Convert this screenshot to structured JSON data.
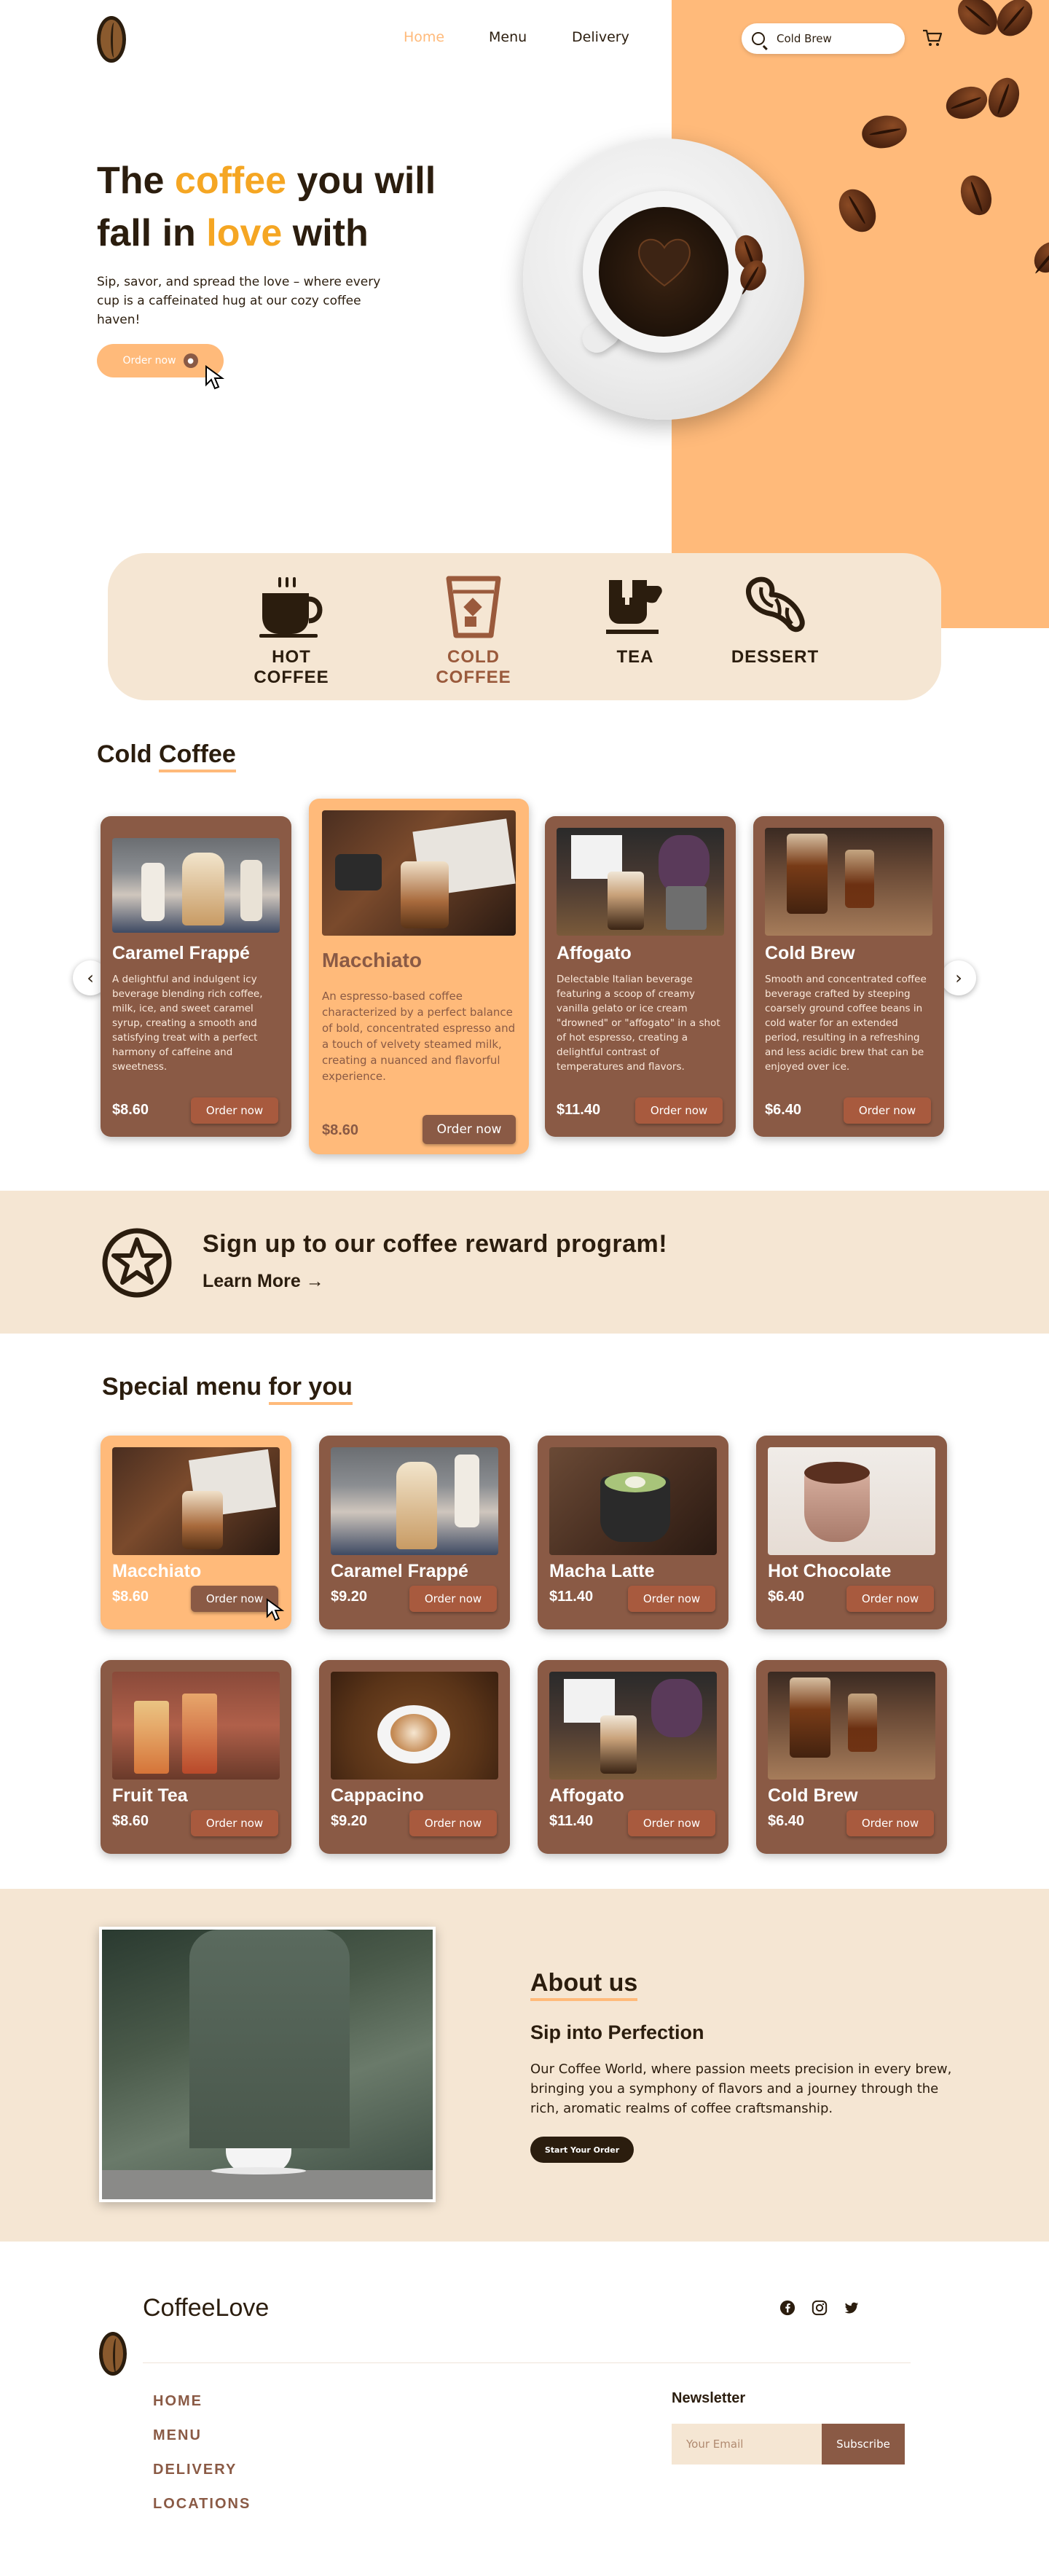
{
  "nav": {
    "items": [
      "Home",
      "Menu",
      "Delivery"
    ],
    "search_value": "Cold Brew"
  },
  "hero": {
    "title_part1": "The ",
    "title_hl1": "coffee",
    "title_part2": " you will",
    "title_part3": "fall in ",
    "title_hl2": "love",
    "title_part4": " with",
    "subtitle": "Sip, savor, and spread the love – where every cup is a caffeinated hug at our cozy coffee haven!",
    "cta": "Order now"
  },
  "categories": [
    {
      "label": "HOT COFFEE",
      "icon": "hot-coffee-cup-icon",
      "active": false
    },
    {
      "label": "COLD COFFEE",
      "icon": "cold-coffee-glass-icon",
      "active": true
    },
    {
      "label": "TEA",
      "icon": "tea-cup-icon",
      "active": false
    },
    {
      "label": "DESSERT",
      "icon": "croissant-icon",
      "active": false
    }
  ],
  "cold_coffee": {
    "title_a": "Cold ",
    "title_b": "Coffee",
    "items": [
      {
        "name": "Caramel Frappé",
        "desc": "A delightful and indulgent icy beverage blending rich coffee, milk, ice, and sweet caramel syrup, creating a smooth and satisfying treat with a perfect harmony of caffeine and sweetness.",
        "price": "$8.60",
        "button": "Order now"
      },
      {
        "name": "Macchiato",
        "desc": "An espresso-based coffee characterized by a perfect balance of bold, concentrated espresso and a touch of velvety steamed milk, creating a nuanced and flavorful experience.",
        "price": "$8.60",
        "button": "Order now"
      },
      {
        "name": "Affogato",
        "desc": "Delectable Italian beverage featuring a scoop of creamy vanilla gelato or ice cream \"drowned\" or \"affogato\" in a shot of hot espresso, creating a delightful contrast of temperatures and flavors.",
        "price": "$11.40",
        "button": "Order now"
      },
      {
        "name": "Cold Brew",
        "desc": "Smooth and concentrated coffee beverage crafted by steeping coarsely ground coffee beans in cold water for an extended period, resulting in a refreshing and less acidic brew that can be enjoyed over ice.",
        "price": "$6.40",
        "button": "Order now"
      }
    ]
  },
  "reward": {
    "title": "Sign up to our coffee reward program!",
    "link": "Learn More"
  },
  "special": {
    "title_a": "Special menu ",
    "title_b": "for you",
    "items": [
      {
        "name": "Macchiato",
        "price": "$8.60",
        "button": "Order now"
      },
      {
        "name": "Caramel Frappé",
        "price": "$9.20",
        "button": "Order now"
      },
      {
        "name": "Macha Latte",
        "price": "$11.40",
        "button": "Order now"
      },
      {
        "name": "Hot Chocolate",
        "price": "$6.40",
        "button": "Order now"
      },
      {
        "name": "Fruit Tea",
        "price": "$8.60",
        "button": "Order now"
      },
      {
        "name": "Cappacino",
        "price": "$9.20",
        "button": "Order now"
      },
      {
        "name": "Affogato",
        "price": "$11.40",
        "button": "Order now"
      },
      {
        "name": "Cold Brew",
        "price": "$6.40",
        "button": "Order now"
      }
    ]
  },
  "about": {
    "title": "About us",
    "subtitle": "Sip into Perfection",
    "text": "Our Coffee World, where passion meets precision in every brew, bringing you a symphony of flavors and a journey through the rich, aromatic realms of coffee craftsmanship.",
    "button": "Start Your Order"
  },
  "footer": {
    "brand": "CoffeeLove",
    "links": [
      "HOME",
      "MENU",
      "DELIVERY",
      "LOCATIONS"
    ],
    "newsletter_title": "Newsletter",
    "email_placeholder": "Your Email",
    "subscribe": "Subscribe"
  },
  "colors": {
    "accent": "#ffba7a",
    "brown": "#8a5a45",
    "dark": "#2b1d0e",
    "cream": "#f5e6d3",
    "highlight": "#f5a623"
  }
}
